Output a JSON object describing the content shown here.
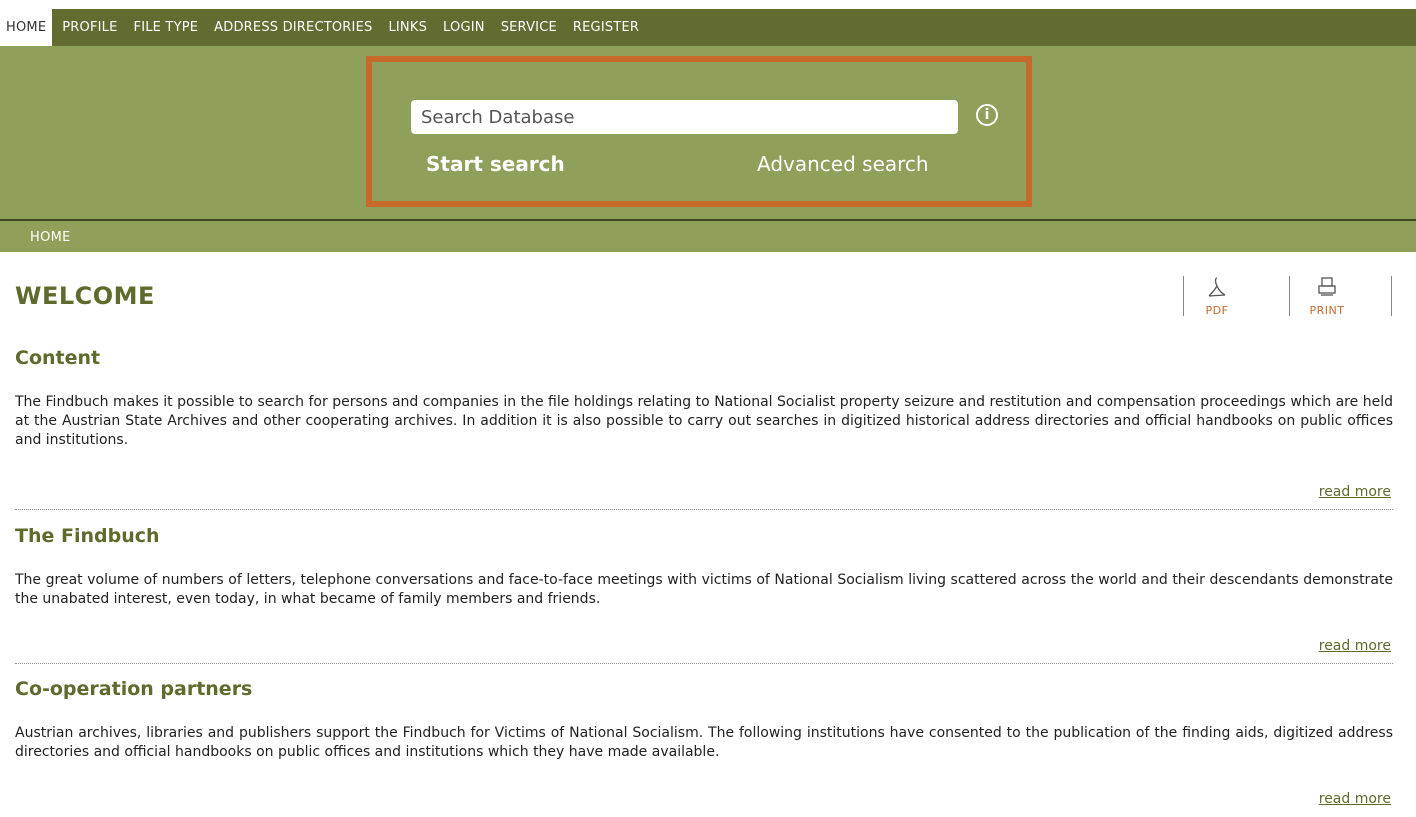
{
  "nav": {
    "items": [
      {
        "label": "HOME",
        "active": true
      },
      {
        "label": "PROFILE"
      },
      {
        "label": "FILE TYPE"
      },
      {
        "label": "ADDRESS DIRECTORIES"
      },
      {
        "label": "LINKS"
      },
      {
        "label": "LOGIN"
      },
      {
        "label": "SERVICE"
      },
      {
        "label": "REGISTER"
      }
    ]
  },
  "search": {
    "placeholder": "Search Database",
    "start_label": "Start search",
    "advanced_label": "Advanced search",
    "info_glyph": "i"
  },
  "breadcrumb": {
    "current": "HOME"
  },
  "page": {
    "title": "WELCOME"
  },
  "tools": {
    "pdf_label": "PDF",
    "print_label": "PRINT"
  },
  "sections": [
    {
      "title": "Content",
      "body": "The Findbuch makes it possible to search for persons and companies in the file holdings relating to National Socialist property seizure and restitution and compensation proceedings which are held at the Austrian State Archives and other cooperating archives. In addition it is also possible to carry out searches in digitized historical address directories and official handbooks on public offices and institutions.",
      "read_more": "read more"
    },
    {
      "title": "The Findbuch",
      "body": "The great volume of numbers of letters, telephone conversations and face-to-face meetings with victims of National Socialism living scattered across the world and their descendants demonstrate the unabated interest, even today, in what became of family members and friends.",
      "read_more": "read more"
    },
    {
      "title": "Co-operation partners",
      "body": "Austrian archives, libraries and publishers support the Findbuch for Victims of National Socialism. The following institutions have consented to the publication of the finding aids, digitized address directories and official handbooks on public offices and institutions which they have made available.",
      "read_more": "read more"
    }
  ],
  "colors": {
    "nav_bg": "#626c31",
    "hero_bg": "#8ea05a",
    "accent_orange": "#c8692c",
    "heading_green": "#5f6b2c"
  }
}
